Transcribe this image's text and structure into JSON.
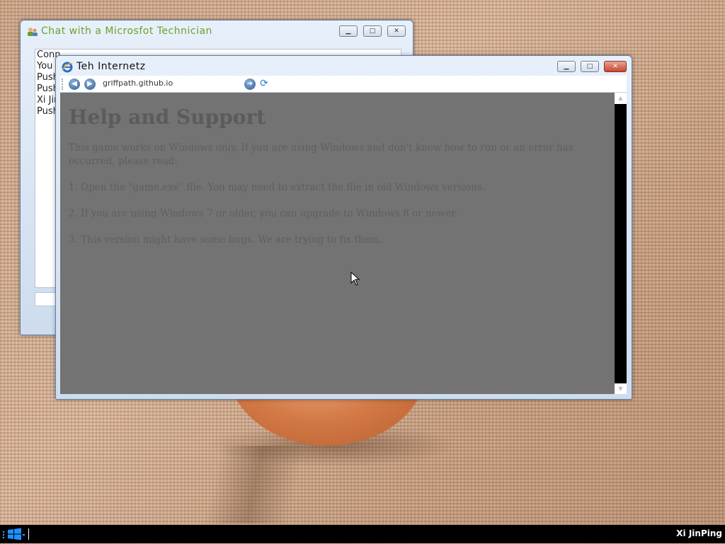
{
  "desktop": {
    "wallpaper": "burlap-with-egg"
  },
  "chat_window": {
    "title": "Chat with a Microsfot Technician",
    "lines": [
      "Conn",
      "You",
      "Push",
      "Push",
      "Xi Jin",
      "Push"
    ],
    "buttons": {
      "minimize": "▁",
      "maximize": "□",
      "close": "✕"
    }
  },
  "browser_window": {
    "title": "Teh Internetz",
    "url": "griffpath.github.io",
    "buttons": {
      "minimize": "▁",
      "maximize": "□",
      "close": "✕"
    },
    "page": {
      "heading": "Help and Support",
      "paragraphs": [
        "This game works on Windows only. If you are using Windows and don't know how to run or an error has occurred, please read:",
        "1. Open the \"game.exe\" file. You may need to extract the file in old Windows versions.",
        "2. If you are using Windows 7 or older, you can upgrade to Windows 8 or newer.",
        "3. This version might have some bugs. We are trying to fix them."
      ]
    }
  },
  "taskbar": {
    "user": "Xi JinPing"
  },
  "colors": {
    "chat_title": "#6aa22c",
    "page_bg": "#737373",
    "taskbar": "#000000"
  }
}
